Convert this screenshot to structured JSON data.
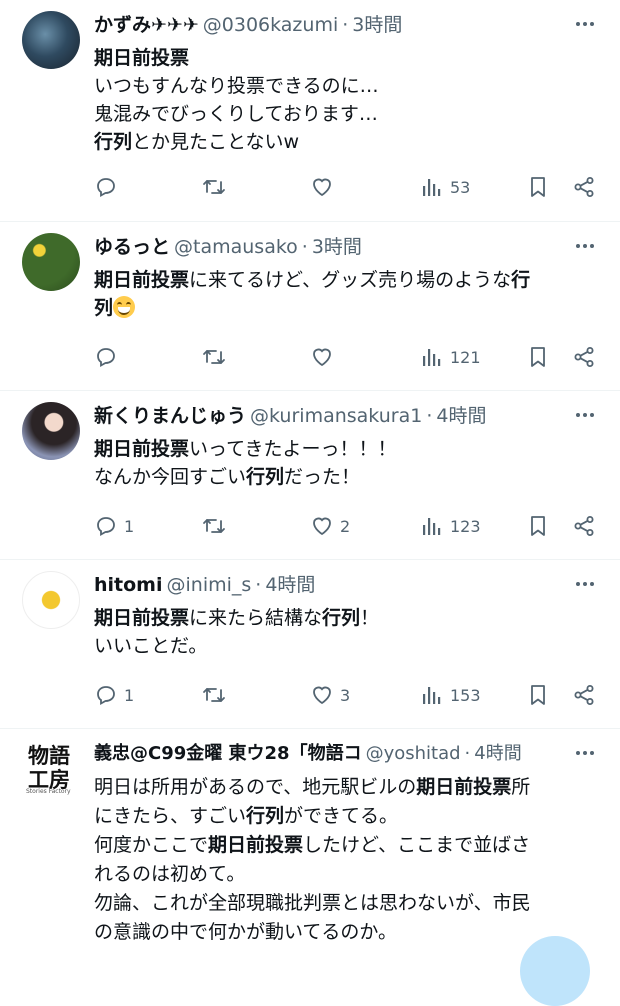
{
  "tweets": [
    {
      "name": "かずみ✈✈✈",
      "handle": "@0306kazumi",
      "time": "3時間",
      "text_lines": [
        [
          {
            "t": "期日前投票",
            "b": true
          }
        ],
        [
          {
            "t": "いつもすんなり投票できるのに…",
            "b": false
          }
        ],
        [
          {
            "t": "鬼混みでびっくりしております…",
            "b": false
          }
        ],
        [
          {
            "t": "行列",
            "b": true
          },
          {
            "t": "とか見たことないw",
            "b": false
          }
        ]
      ],
      "replies": "",
      "retweets": "",
      "likes": "",
      "views": "53"
    },
    {
      "name": "ゆるっと",
      "handle": "@tamausako",
      "time": "3時間",
      "text_lines": [
        [
          {
            "t": "期日前投票",
            "b": true
          },
          {
            "t": "に来てるけど、グッズ売り場のような",
            "b": false
          },
          {
            "t": "行",
            "b": true
          }
        ],
        [
          {
            "t": "列",
            "b": true
          }
        ]
      ],
      "replies": "",
      "retweets": "",
      "likes": "",
      "views": "121"
    },
    {
      "name": "新くりまんじゅう",
      "handle": "@kurimansakura1",
      "time": "4時間",
      "text_lines": [
        [
          {
            "t": "期日前投票",
            "b": true
          },
          {
            "t": "いってきたよーっ！！！",
            "b": false
          }
        ],
        [
          {
            "t": "なんか今回すごい",
            "b": false
          },
          {
            "t": "行列",
            "b": true
          },
          {
            "t": "だった！",
            "b": false
          }
        ]
      ],
      "replies": "1",
      "retweets": "",
      "likes": "2",
      "views": "123"
    },
    {
      "name": "hitomi",
      "handle": "@inimi_s",
      "time": "4時間",
      "text_lines": [
        [
          {
            "t": "期日前投票",
            "b": true
          },
          {
            "t": "に来たら結構な",
            "b": false
          },
          {
            "t": "行列",
            "b": true
          },
          {
            "t": "！",
            "b": false
          }
        ],
        [
          {
            "t": "いいことだ。",
            "b": false
          }
        ]
      ],
      "replies": "1",
      "retweets": "",
      "likes": "3",
      "views": "153"
    },
    {
      "name": "義忠@C99金曜 東ウ28「物語コ",
      "handle": "@yoshitad",
      "time": "4時間",
      "avatar_text_1": "物語",
      "avatar_text_2": "工房",
      "avatar_text_3": "Stories Factory",
      "text_lines": [
        [
          {
            "t": "明日は所用があるので、地元駅ビルの",
            "b": false
          },
          {
            "t": "期日前投票",
            "b": true
          },
          {
            "t": "所",
            "b": false
          }
        ],
        [
          {
            "t": "にきたら、すごい",
            "b": false
          },
          {
            "t": "行列",
            "b": true
          },
          {
            "t": "ができてる。",
            "b": false
          }
        ],
        [
          {
            "t": "何度かここで",
            "b": false
          },
          {
            "t": "期日前投票",
            "b": true
          },
          {
            "t": "したけど、ここまで並ばさ",
            "b": false
          }
        ],
        [
          {
            "t": "れるのは初めて。",
            "b": false
          }
        ],
        [
          {
            "t": "勿論、これが全部現職批判票とは思わないが、市民",
            "b": false
          }
        ],
        [
          {
            "t": "の意識の中で何かが動いてるのか。",
            "b": false
          }
        ]
      ]
    }
  ],
  "icons": {
    "reply": "reply-icon",
    "retweet": "retweet-icon",
    "like": "like-icon",
    "views": "views-icon",
    "bookmark": "bookmark-icon",
    "share": "share-icon",
    "more": "more-icon",
    "emoji": "grinning-face-emoji"
  },
  "colors": {
    "text": "#0f1419",
    "secondary": "#536471",
    "divider": "#eff3f4",
    "fab": "#bfe4fb"
  }
}
